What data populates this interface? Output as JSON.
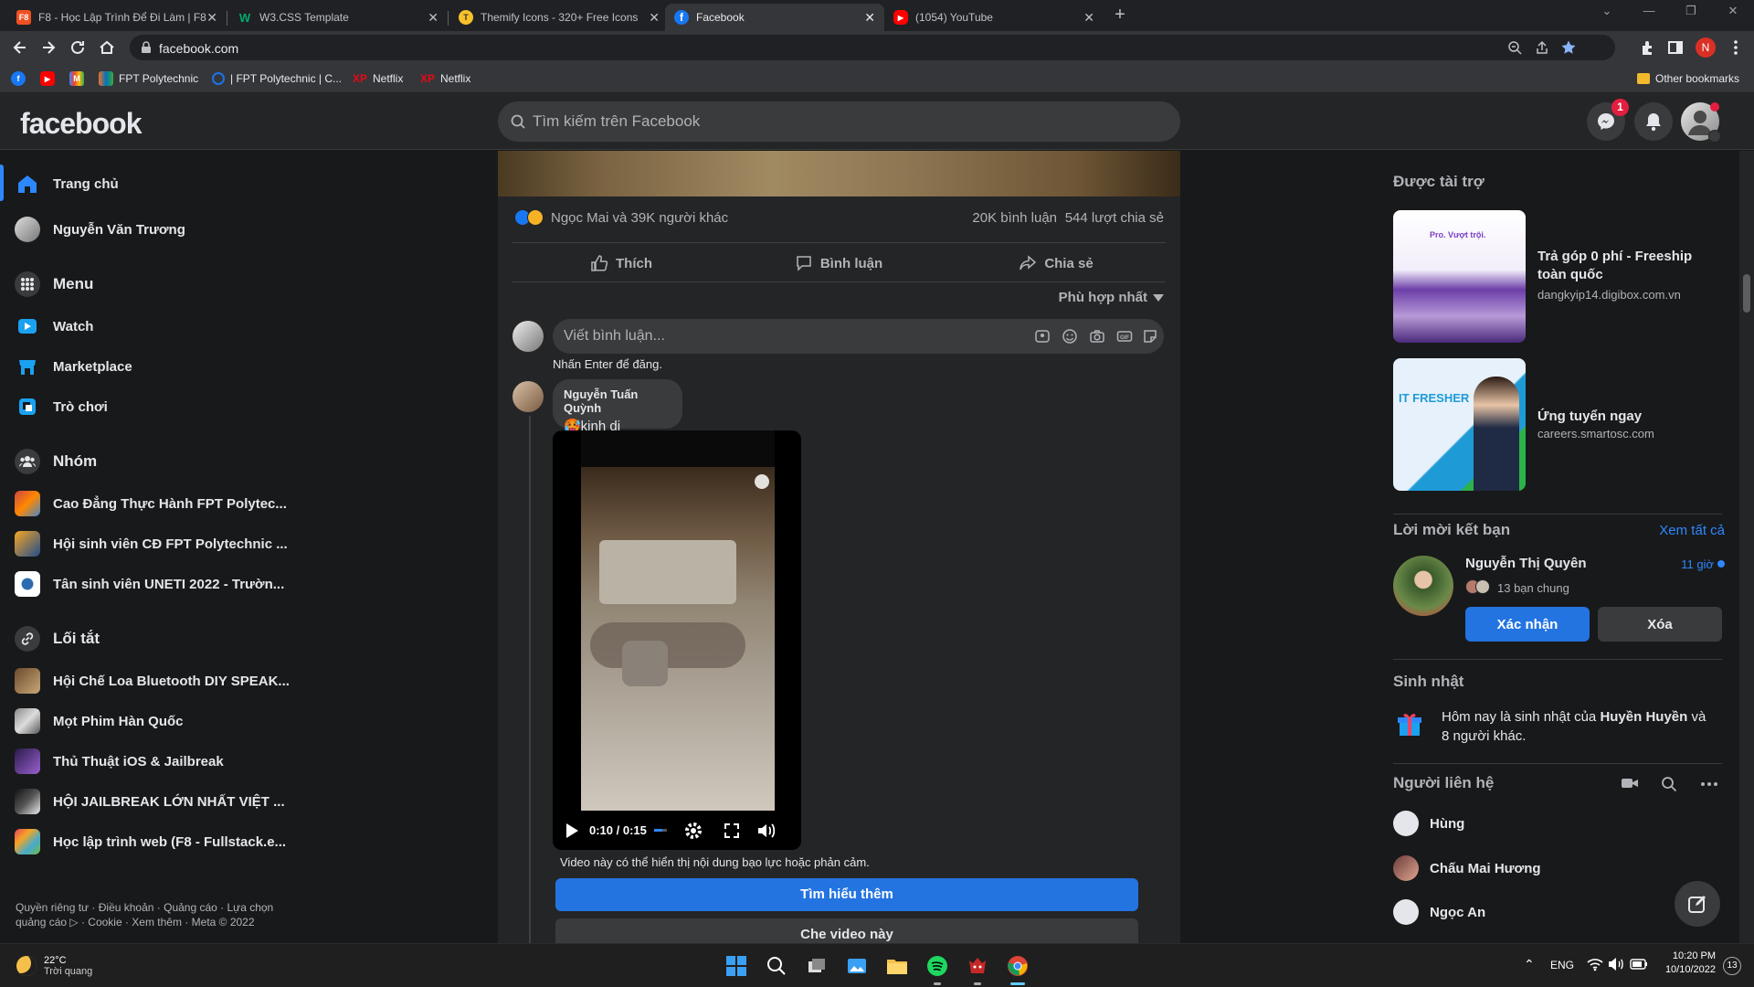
{
  "browser": {
    "tabs": [
      {
        "title": "F8 - Học Lập Trình Để Đi Làm | F8",
        "favicon": "F8"
      },
      {
        "title": "W3.CSS Template",
        "favicon": "W"
      },
      {
        "title": "Themify Icons - 320+ Free Icons",
        "favicon": "T"
      },
      {
        "title": "Facebook",
        "favicon": "f"
      },
      {
        "title": "(1054) YouTube",
        "favicon": "▶"
      }
    ],
    "url": "facebook.com",
    "bookmarks": [
      {
        "label": "FPT Polytechnic"
      },
      {
        "label": "| FPT Polytechnic | C..."
      },
      {
        "label": "Netflix"
      },
      {
        "label": "Netflix"
      }
    ],
    "other_bookmarks": "Other bookmarks",
    "profile_initial": "N"
  },
  "header": {
    "logo": "facebook",
    "search_placeholder": "Tìm kiếm trên Facebook",
    "messenger_badge": "1"
  },
  "left_nav": {
    "home": "Trang chủ",
    "profile": "Nguyễn Văn Trương",
    "menu": "Menu",
    "watch": "Watch",
    "marketplace": "Marketplace",
    "gaming": "Trò chơi",
    "groups_header": "Nhóm",
    "groups": [
      "Cao Đẳng Thực Hành FPT Polytec...",
      "Hội sinh viên CĐ FPT Polytechnic ...",
      "Tân sinh viên UNETI 2022 - Trườn..."
    ],
    "shortcuts_header": "Lối tắt",
    "shortcuts": [
      "Hội Chế Loa Bluetooth DIY SPEAK...",
      "Mọt Phim Hàn Quốc",
      "Thủ Thuật iOS & Jailbreak",
      "HỘI JAILBREAK LỚN NHẤT VIỆT ...",
      "Học lập trình web (F8 - Fullstack.e..."
    ],
    "legal": "Quyền riêng tư · Điều khoản · Quảng cáo · Lựa chọn quảng cáo ▷ · Cookie · Xem thêm · Meta © 2022"
  },
  "post": {
    "reactions_text": "Ngọc Mai và 39K người khác",
    "comments_count": "20K bình luận",
    "shares_count": "544 lượt chia sẻ",
    "like_label": "Thích",
    "comment_label": "Bình luận",
    "share_label": "Chia sẻ",
    "sort_label": "Phù hợp nhất",
    "comment_placeholder": "Viết bình luận...",
    "enter_hint": "Nhấn Enter để đăng.",
    "comment": {
      "author": "Nguyễn Tuấn Quỳnh",
      "text": "🥵kinh dị"
    },
    "video": {
      "time": "0:10 / 0:15",
      "progress": 0.667
    },
    "warning": "Video này có thể hiển thị nội dung bạo lực hoặc phản cảm.",
    "learn_more": "Tìm hiểu thêm",
    "hide_video": "Che video này"
  },
  "right_rail": {
    "sponsored_header": "Được tài trợ",
    "ads": [
      {
        "title": "Trả góp 0 phí - Freeship toàn quốc",
        "url": "dangkyip14.digibox.com.vn",
        "img_text": "Pro. Vượt trội."
      },
      {
        "title": "Ứng tuyển ngay",
        "url": "careers.smartosc.com",
        "img_text": "IT FRESHER"
      }
    ],
    "friend_requests_header": "Lời mời kết bạn",
    "see_all": "Xem tất cả",
    "friend_request": {
      "name": "Nguyễn Thị Quyên",
      "time": "11 giờ",
      "mutual": "13 bạn chung",
      "confirm": "Xác nhận",
      "delete": "Xóa"
    },
    "birthdays_header": "Sinh nhật",
    "birthday_prefix": "Hôm nay là sinh nhật của ",
    "birthday_name": "Huyền Huyền",
    "birthday_suffix": " và 8 người khác.",
    "contacts_header": "Người liên hệ",
    "contacts": [
      "Hùng",
      "Chấu Mai Hương",
      "Ngọc An"
    ]
  },
  "taskbar": {
    "temperature": "22°C",
    "weather": "Trời quang",
    "language": "ENG",
    "time": "10:20 PM",
    "date": "10/10/2022",
    "notifications": "13"
  },
  "colors": {
    "accent": "#2374e1",
    "background": "#18191a",
    "surface": "#242526",
    "badge": "#e41e3f"
  }
}
